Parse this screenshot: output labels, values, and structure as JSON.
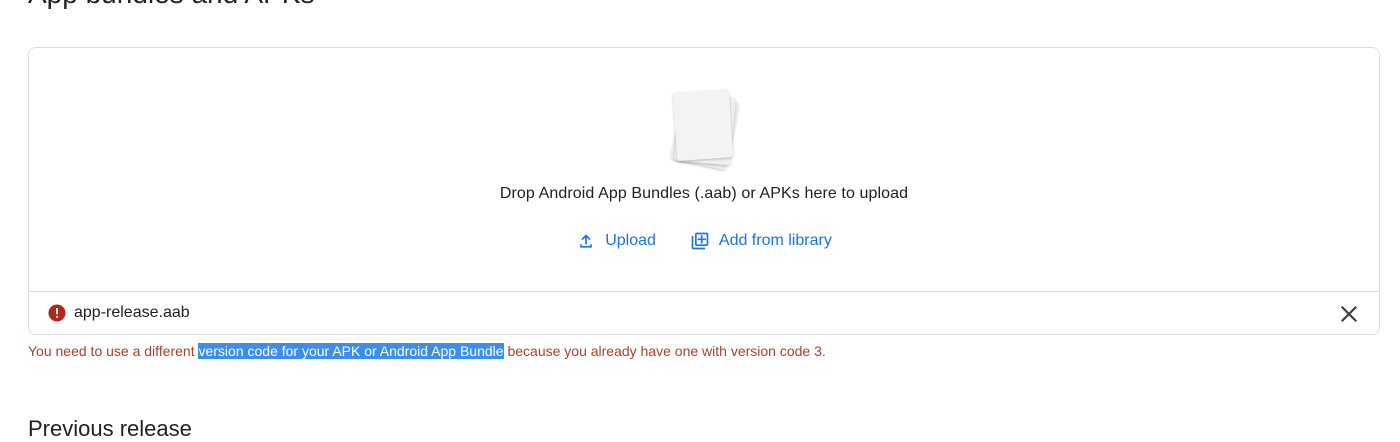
{
  "page": {
    "section_title": "App bundles and APKs",
    "next_section_title": "Previous release"
  },
  "dropzone": {
    "illustration": "stacked-files-illustration",
    "instruction": "Drop Android App Bundles (.aab) or APKs here to upload",
    "upload_label": "Upload",
    "upload_icon": "upload-icon",
    "library_label": "Add from library",
    "library_icon": "add-to-library-icon"
  },
  "file": {
    "name": "app-release.aab",
    "status_icon": "error-icon",
    "remove_icon": "close-icon"
  },
  "error": {
    "text_before": "You need to use a different ",
    "text_highlighted": "version code for your APK or Android App Bundle",
    "text_after": " because you already have one with version code 3."
  },
  "colors": {
    "accent": "#1a73e8",
    "error": "#a8412e",
    "error_icon": "#b3261e",
    "selection": "#3b8eea",
    "border": "#dadce0"
  }
}
